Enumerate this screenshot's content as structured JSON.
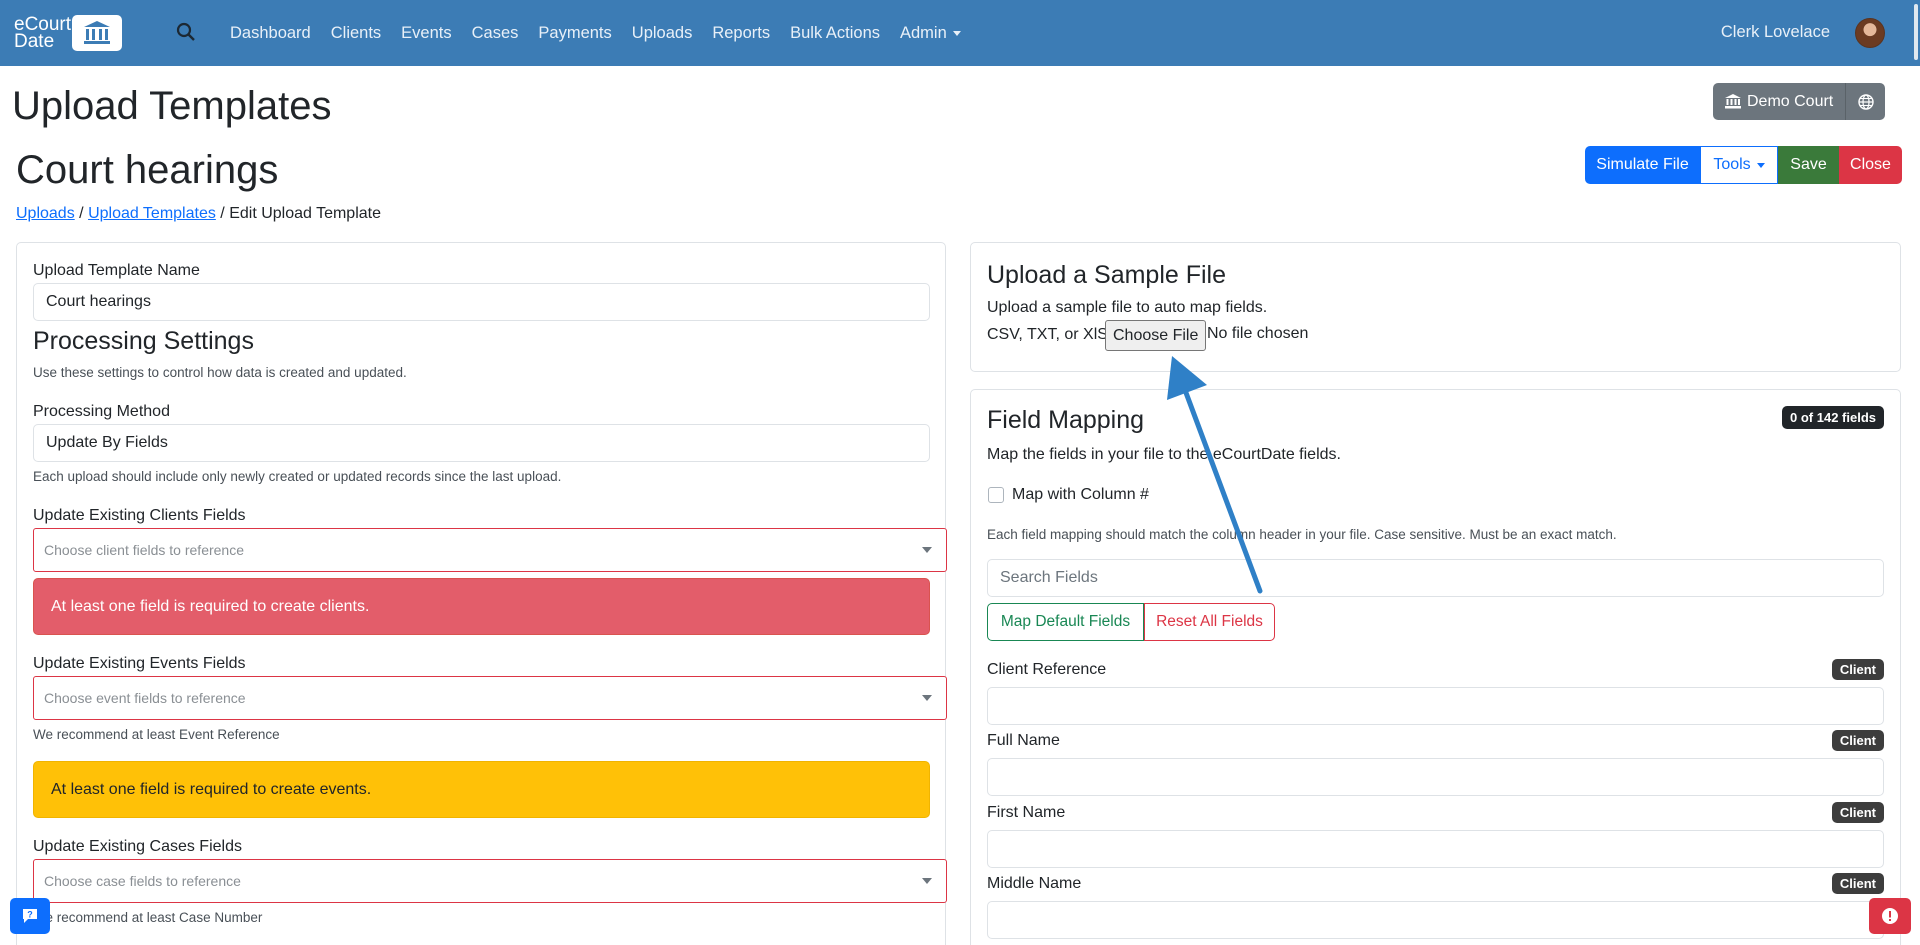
{
  "navbar": {
    "brand_line1": "eCourt",
    "brand_line2": "Date",
    "links": [
      "Dashboard",
      "Clients",
      "Events",
      "Cases",
      "Payments",
      "Uploads",
      "Reports",
      "Bulk Actions",
      "Admin"
    ],
    "user_name": "Clerk Lovelace"
  },
  "header": {
    "page_title": "Upload Templates",
    "template_title": "Court hearings",
    "court_button": "Demo Court",
    "simulate_button": "Simulate File",
    "tools_button": "Tools",
    "save_button": "Save",
    "close_button": "Close"
  },
  "breadcrumb": {
    "item1": "Uploads",
    "sep": "/",
    "item2": "Upload Templates",
    "current": "Edit Upload Template"
  },
  "left": {
    "name_label": "Upload Template Name",
    "name_value": "Court hearings",
    "processing_title": "Processing Settings",
    "processing_desc": "Use these settings to control how data is created and updated.",
    "method_label": "Processing Method",
    "method_value": "Update By Fields",
    "method_help": "Each upload should include only newly created or updated records since the last upload.",
    "clients_label": "Update Existing Clients Fields",
    "clients_placeholder": "Choose client fields to reference",
    "clients_alert": "At least one field is required to create clients.",
    "events_label": "Update Existing Events Fields",
    "events_placeholder": "Choose event fields to reference",
    "events_help": "We recommend at least Event Reference",
    "events_alert": "At least one field is required to create events.",
    "cases_label": "Update Existing Cases Fields",
    "cases_placeholder": "Choose case fields to reference",
    "cases_help": "We recommend at least Case Number"
  },
  "upload": {
    "title": "Upload a Sample File",
    "desc": "Upload a sample file to auto map fields.",
    "formats": "CSV, TXT, or XlSX",
    "choose_button": "Choose File",
    "file_status": "No file chosen"
  },
  "mapping": {
    "title": "Field Mapping",
    "count_badge": "0 of 142 fields",
    "desc": "Map the fields in your file to the eCourtDate fields.",
    "map_column_label": "Map with Column #",
    "help": "Each field mapping should match the column header in your file. Case sensitive. Must be an exact match.",
    "search_placeholder": "Search Fields",
    "map_default_button": "Map Default Fields",
    "reset_button": "Reset All Fields",
    "fields": [
      {
        "name": "Client Reference",
        "tag": "Client"
      },
      {
        "name": "Full Name",
        "tag": "Client"
      },
      {
        "name": "First Name",
        "tag": "Client"
      },
      {
        "name": "Middle Name",
        "tag": "Client"
      }
    ]
  },
  "colors": {
    "navbar": "#3c7cb5",
    "primary": "#0d6efd",
    "success": "#198754",
    "danger": "#dc3545",
    "warning": "#ffc107",
    "annotation_arrow": "#2f80c7"
  },
  "icons": {
    "search": "search-icon",
    "court": "bank-icon",
    "globe": "globe-icon",
    "help": "chat-help-icon",
    "error": "error-icon"
  }
}
